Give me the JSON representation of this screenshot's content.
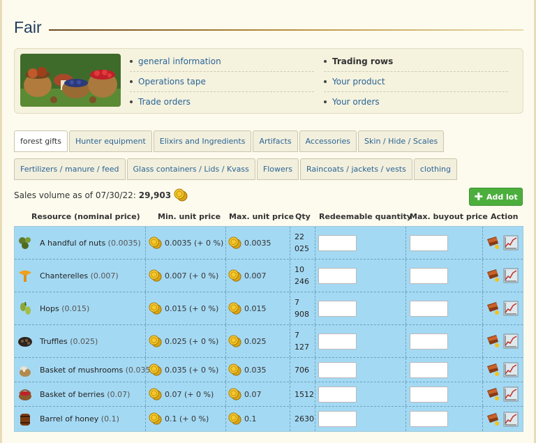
{
  "page": {
    "title": "Fair"
  },
  "info_links": {
    "col1": [
      {
        "label": "general information",
        "current": false
      },
      {
        "label": "Operations tape",
        "current": false
      },
      {
        "label": "Trade orders",
        "current": false
      }
    ],
    "col2": [
      {
        "label": "Trading rows",
        "current": true
      },
      {
        "label": "Your product",
        "current": false
      },
      {
        "label": "Your orders",
        "current": false
      }
    ]
  },
  "tabs": {
    "row1": [
      {
        "label": "forest gifts",
        "active": true
      },
      {
        "label": "Hunter equipment",
        "active": false
      },
      {
        "label": "Elixirs and Ingredients",
        "active": false
      },
      {
        "label": "Artifacts",
        "active": false
      },
      {
        "label": "Accessories",
        "active": false
      },
      {
        "label": "Skin / Hide / Scales",
        "active": false
      }
    ],
    "row2": [
      {
        "label": "Fertilizers / manure / feed",
        "active": false
      },
      {
        "label": "Glass containers / Lids / Kvass",
        "active": false
      },
      {
        "label": "Flowers",
        "active": false
      },
      {
        "label": "Raincoats / jackets / vests",
        "active": false
      },
      {
        "label": "clothing",
        "active": false
      }
    ]
  },
  "sales": {
    "label": "Sales volume as of 07/30/22:",
    "value": "29,903"
  },
  "add_lot": {
    "label": "Add lot"
  },
  "table": {
    "headers": {
      "resource": "Resource (nominal price)",
      "min_price": "Min. unit price",
      "max_price": "Max. unit price",
      "qty": "Qty",
      "redeemable": "Redeemable quantity",
      "max_buyout": "Max. buyout price",
      "action": "Action"
    },
    "rows": [
      {
        "icon": "nuts-icon",
        "name": "A handful of nuts",
        "nominal": "(0.0035)",
        "min": "0.0035 (+ 0 %)",
        "max": "0.0035",
        "qty1": "22",
        "qty2": "025"
      },
      {
        "icon": "chanterelle-icon",
        "name": "Chanterelles",
        "nominal": "(0.007)",
        "min": "0.007 (+ 0 %)",
        "max": "0.007",
        "qty1": "10",
        "qty2": "246"
      },
      {
        "icon": "hops-icon",
        "name": "Hops",
        "nominal": "(0.015)",
        "min": "0.015 (+ 0 %)",
        "max": "0.015",
        "qty1": "7",
        "qty2": "908"
      },
      {
        "icon": "truffle-icon",
        "name": "Truffles",
        "nominal": "(0.025)",
        "min": "0.025 (+ 0 %)",
        "max": "0.025",
        "qty1": "7",
        "qty2": "127"
      },
      {
        "icon": "mushroom-basket-icon",
        "name": "Basket of mushrooms",
        "nominal": "(0.035)",
        "min": "0.035 (+ 0 %)",
        "max": "0.035",
        "qty1": "706",
        "qty2": ""
      },
      {
        "icon": "berry-basket-icon",
        "name": "Basket of berries",
        "nominal": "(0.07)",
        "min": "0.07 (+ 0 %)",
        "max": "0.07",
        "qty1": "1512",
        "qty2": ""
      },
      {
        "icon": "honey-barrel-icon",
        "name": "Barrel of honey",
        "nominal": "(0.1)",
        "min": "0.1 (+ 0 %)",
        "max": "0.1",
        "qty1": "2630",
        "qty2": ""
      }
    ]
  },
  "colors": {
    "row_bg": "#a4d9f3",
    "link": "#2a6496",
    "add_button": "#4caf3d"
  }
}
